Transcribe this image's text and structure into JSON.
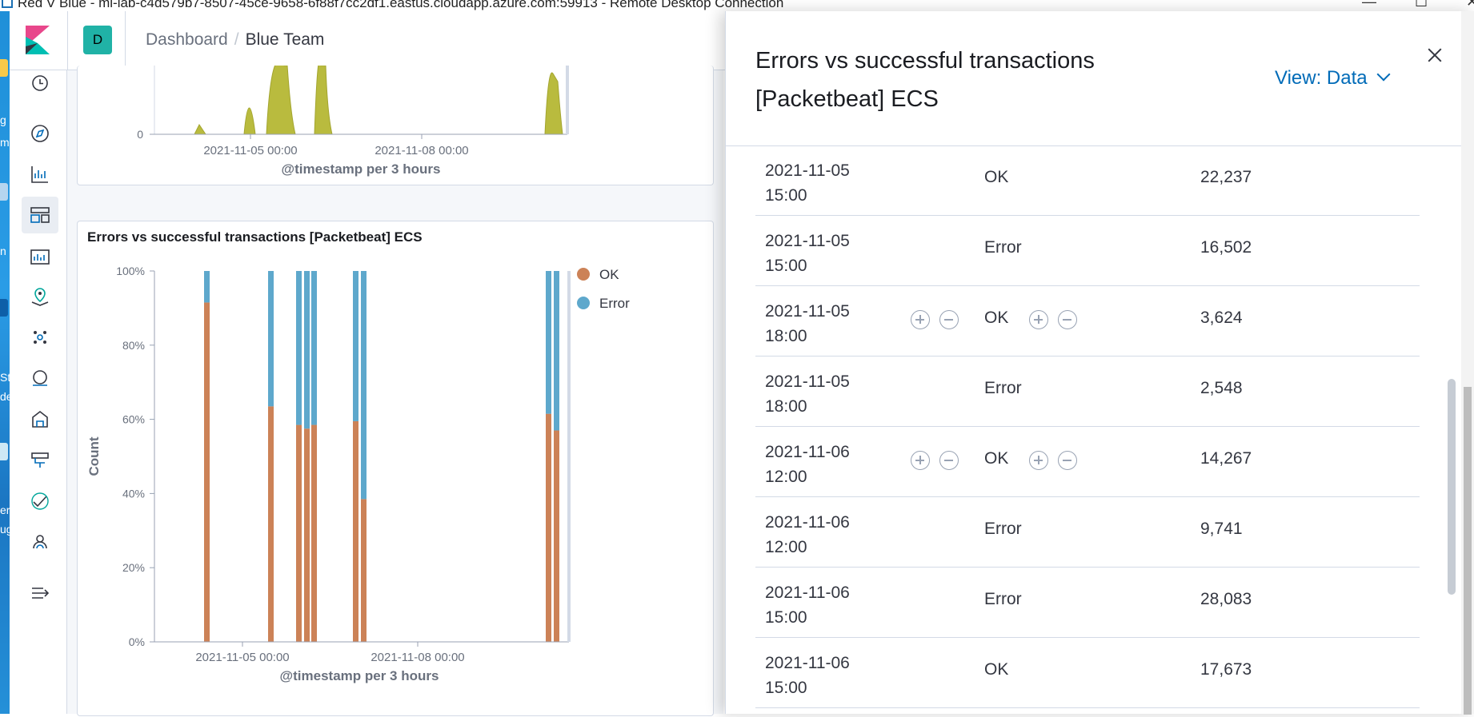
{
  "window": {
    "title": "Red V Blue - ml-lab-c4d579b7-8507-45ce-9658-6f88f7cc2df1.eastus.cloudapp.azure.com:59913 - Remote Desktop Connection",
    "minimize": "—",
    "maximize": "☐",
    "close": "✕"
  },
  "host_fragments": [
    "g",
    "m",
    "n",
    "St",
    "de",
    "er",
    "ug"
  ],
  "header": {
    "space_initial": "D",
    "breadcrumbs": [
      "Dashboard",
      "Blue Team"
    ],
    "crumb_sep": "/"
  },
  "nav": {
    "items": [
      "clock-icon",
      "discover-icon",
      "visualize-icon",
      "dashboard-icon",
      "canvas-icon",
      "maps-icon",
      "ml-icon",
      "infrastructure-icon",
      "logs-icon",
      "apm-icon",
      "uptime-icon",
      "siem-icon",
      "dev-tools-icon"
    ],
    "collapse": "expand-nav-icon"
  },
  "top_panel": {
    "y_tick": "0",
    "x_ticks": [
      "2021-11-05 00:00",
      "2021-11-08 00:00"
    ],
    "xlabel": "@timestamp per 3 hours"
  },
  "chart_panel": {
    "title": "Errors vs successful transactions [Packetbeat] ECS"
  },
  "chart_data": [
    {
      "type": "area",
      "title": "",
      "xlabel": "@timestamp per 3 hours",
      "ylabel": "",
      "x_ticks": [
        "2021-11-05 00:00",
        "2021-11-08 00:00"
      ],
      "y_ticks": [
        "0"
      ],
      "colors": [
        "#b9bb3e"
      ],
      "note_visible": "cropped area chart, only lower portion visible"
    },
    {
      "type": "bar",
      "stacked_percent": true,
      "title": "Errors vs successful transactions [Packetbeat] ECS",
      "xlabel": "@timestamp per 3 hours",
      "ylabel": "Count",
      "y_ticks": [
        "0%",
        "20%",
        "40%",
        "60%",
        "80%",
        "100%"
      ],
      "ylim": [
        0,
        100
      ],
      "x_ticks": [
        "2021-11-05 00:00",
        "2021-11-08 00:00"
      ],
      "legend": {
        "position": "right",
        "entries": [
          {
            "name": "OK",
            "color": "#cc8257"
          },
          {
            "name": "Error",
            "color": "#5ea8cc"
          }
        ]
      },
      "series": [
        {
          "name": "OK",
          "values": [
            91.5,
            63.5,
            58.5,
            57.5,
            58.5,
            59.5,
            38.5,
            61.5,
            57
          ]
        },
        {
          "name": "Error",
          "values": [
            8.5,
            36.5,
            41.5,
            42.5,
            41.5,
            40.5,
            61.5,
            38.5,
            43
          ]
        }
      ]
    }
  ],
  "flyout": {
    "title_line1": "Errors vs successful transactions",
    "title_line2": "[Packetbeat] ECS",
    "view_label": "View: Data",
    "rows": [
      {
        "time": "2021-11-05\n15:00",
        "status": "OK",
        "count": "22,237",
        "filters": false
      },
      {
        "time": "2021-11-05\n15:00",
        "status": "Error",
        "count": "16,502",
        "filters": false
      },
      {
        "time": "2021-11-05\n18:00",
        "status": "OK",
        "count": "3,624",
        "filters": true
      },
      {
        "time": "2021-11-05\n18:00",
        "status": "Error",
        "count": "2,548",
        "filters": false
      },
      {
        "time": "2021-11-06\n12:00",
        "status": "OK",
        "count": "14,267",
        "filters": true
      },
      {
        "time": "2021-11-06\n12:00",
        "status": "Error",
        "count": "9,741",
        "filters": false
      },
      {
        "time": "2021-11-06\n15:00",
        "status": "Error",
        "count": "28,083",
        "filters": false
      },
      {
        "time": "2021-11-06\n15:00",
        "status": "OK",
        "count": "17,673",
        "filters": false
      }
    ]
  }
}
